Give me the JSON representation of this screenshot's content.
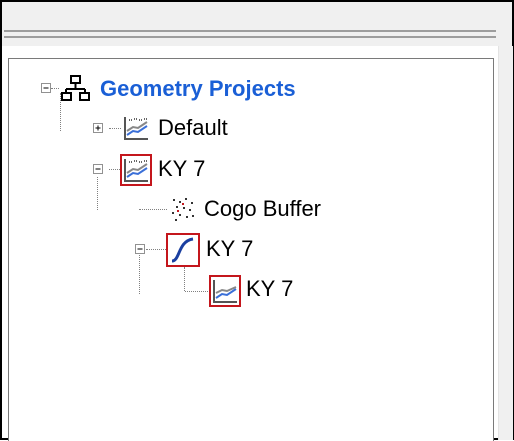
{
  "tree": {
    "root": {
      "label": "Geometry Projects",
      "icon": "hierarchy-icon",
      "expanded": true,
      "selected": true
    },
    "nodes": [
      {
        "label": "Default",
        "icon": "chart-icon",
        "expanded": false
      },
      {
        "label": "KY 7",
        "icon": "chart-icon",
        "expanded": true
      },
      {
        "label": "Cogo Buffer",
        "icon": "point-cloud-icon"
      },
      {
        "label": "KY 7",
        "icon": "alignment-curve-icon",
        "expanded": true
      },
      {
        "label": "KY 7",
        "icon": "profile-icon"
      }
    ]
  },
  "colors": {
    "selection_text": "#1a5fd6",
    "icon_frame": "#c4161c",
    "tree_lines": "#808080",
    "chrome": "#f0f0f0"
  }
}
